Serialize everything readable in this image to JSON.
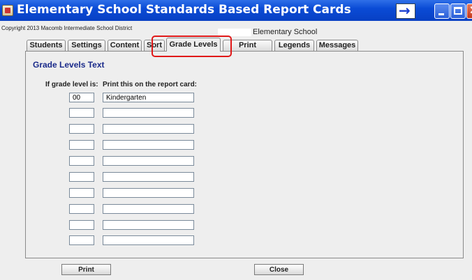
{
  "window": {
    "title": "Elementary School Standards Based Report Cards",
    "icon": "report-card-app-icon",
    "controls": {
      "arrow": "→",
      "minimize": "minimize-icon",
      "maximize": "maximize-icon",
      "close": "✕"
    }
  },
  "header": {
    "copyright": "Copyright 2013 Macomb Intermediate School District",
    "school_name": "Elementary School"
  },
  "tabs": [
    {
      "label": "Students"
    },
    {
      "label": "Settings"
    },
    {
      "label": "Content"
    },
    {
      "label": "Sort"
    },
    {
      "label": "Grade Levels",
      "active": true
    },
    {
      "label": "Print Options"
    },
    {
      "label": "Legends"
    },
    {
      "label": "Messages"
    }
  ],
  "panel": {
    "title": "Grade Levels Text",
    "col_grade_level": "If grade level is:",
    "col_print": "Print this on the report card:",
    "rows": [
      {
        "grade": "00",
        "text": "Kindergarten"
      },
      {
        "grade": "",
        "text": ""
      },
      {
        "grade": "",
        "text": ""
      },
      {
        "grade": "",
        "text": ""
      },
      {
        "grade": "",
        "text": ""
      },
      {
        "grade": "",
        "text": ""
      },
      {
        "grade": "",
        "text": ""
      },
      {
        "grade": "",
        "text": ""
      },
      {
        "grade": "",
        "text": ""
      },
      {
        "grade": "",
        "text": ""
      }
    ]
  },
  "buttons": {
    "print": "Print",
    "close": "Close"
  },
  "colors": {
    "titlebar": "#0a4bd6",
    "panel_title": "#1a2a8a",
    "highlight": "#e01818"
  }
}
